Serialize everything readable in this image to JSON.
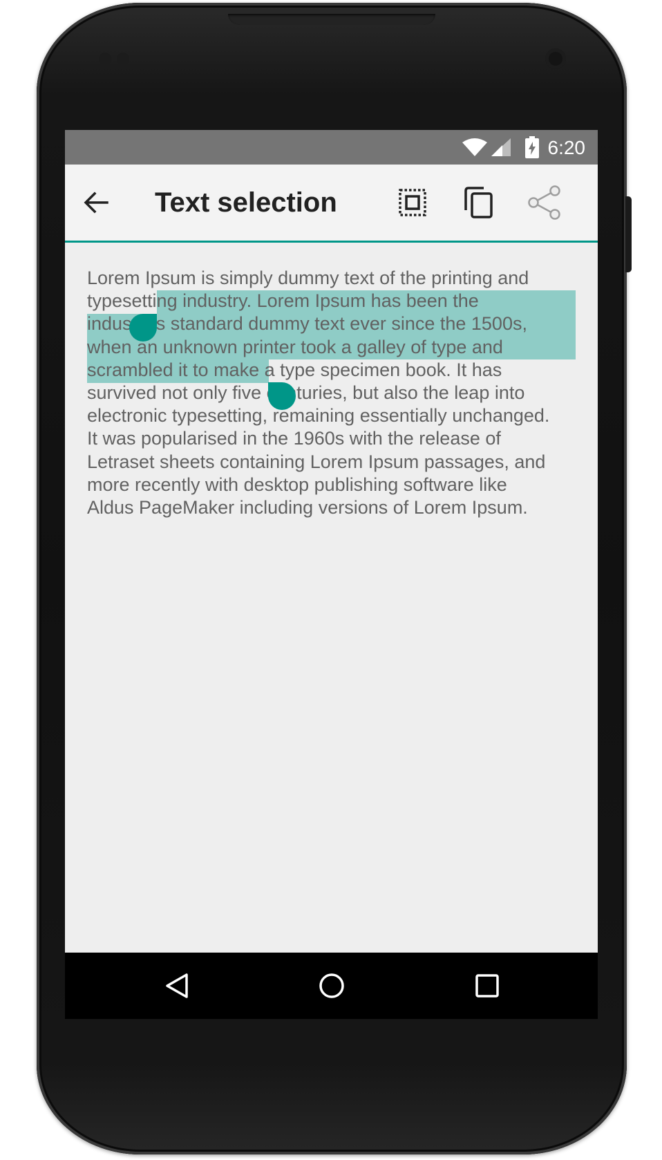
{
  "status_bar": {
    "time": "6:20",
    "icons": [
      "wifi-icon",
      "signal-icon",
      "battery-charging-icon"
    ],
    "background": "#757575"
  },
  "app_bar": {
    "title": "Text selection",
    "actions": [
      "back-arrow-icon",
      "select-all-icon",
      "copy-icon",
      "share-icon"
    ],
    "accent": "#009688"
  },
  "content": {
    "lines": [
      "Lorem Ipsum is simply dummy text of the printing and",
      "typesetting industry. Lorem Ipsum has been the",
      "industry's standard dummy text ever since the 1500s,",
      "when an unknown printer took a galley of type and",
      "scrambled it to make a type specimen book. It has",
      "survived not only five centuries, but also the leap into",
      "electronic typesetting, remaining essentially unchanged.",
      "It was popularised in the 1960s with the release of",
      "Letraset sheets containing Lorem Ipsum passages, and",
      "more recently with desktop publishing software like",
      "Aldus PageMaker including versions of Lorem Ipsum."
    ],
    "selection_color": "#8fccc6",
    "handle_color": "#009688"
  },
  "nav_bar": {
    "buttons": [
      "back-triangle-icon",
      "home-circle-icon",
      "recents-square-icon"
    ]
  }
}
